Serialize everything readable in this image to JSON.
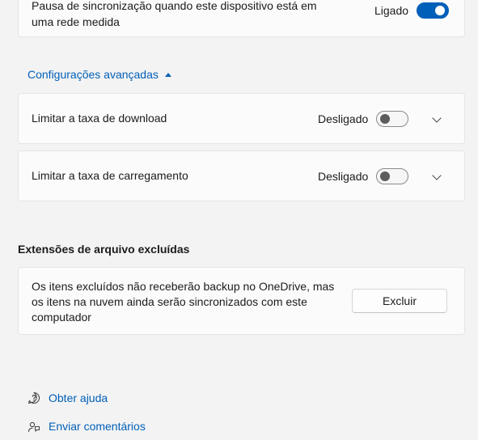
{
  "sync_pause": {
    "text": "Pausa de sincronização quando este dispositivo está em uma rede medida",
    "state": "Ligado"
  },
  "advanced": {
    "label": "Configurações avançadas"
  },
  "download_limit": {
    "label": "Limitar a taxa de download",
    "state": "Desligado"
  },
  "upload_limit": {
    "label": "Limitar a taxa de carregamento",
    "state": "Desligado"
  },
  "excluded": {
    "title": "Extensões de arquivo excluídas",
    "text": "Os itens excluídos não receberão backup no OneDrive, mas os itens na nuvem ainda serão sincronizados com este computador",
    "button": "Excluir"
  },
  "footer": {
    "help": "Obter ajuda",
    "feedback": "Enviar comentários"
  },
  "colors": {
    "accent": "#005fb8",
    "background": "#f3f3f3",
    "card": "#fbfbfb"
  }
}
